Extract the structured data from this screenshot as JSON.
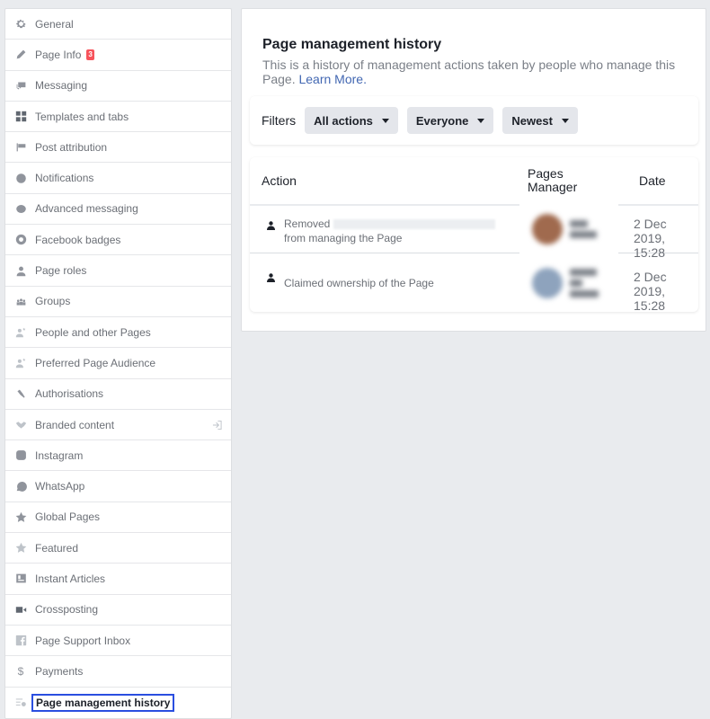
{
  "sidebar": {
    "items": [
      {
        "label": "General",
        "icon": "gear-icon"
      },
      {
        "label": "Page Info",
        "icon": "pencil-icon",
        "badge": "3"
      },
      {
        "label": "Messaging",
        "icon": "chat-bubbles-icon"
      },
      {
        "label": "Templates and tabs",
        "icon": "grid-icon"
      },
      {
        "label": "Post attribution",
        "icon": "flag-icon"
      },
      {
        "label": "Notifications",
        "icon": "globe-icon"
      },
      {
        "label": "Advanced messaging",
        "icon": "messenger-icon"
      },
      {
        "label": "Facebook badges",
        "icon": "badge-icon"
      },
      {
        "label": "Page roles",
        "icon": "person-icon"
      },
      {
        "label": "Groups",
        "icon": "group-icon"
      },
      {
        "label": "People and other Pages",
        "icon": "person-star-icon"
      },
      {
        "label": "Preferred Page Audience",
        "icon": "person-star-icon"
      },
      {
        "label": "Authorisations",
        "icon": "wrench-icon"
      },
      {
        "label": "Branded content",
        "icon": "handshake-icon",
        "trailing_icon": "external-link-icon"
      },
      {
        "label": "Instagram",
        "icon": "instagram-icon"
      },
      {
        "label": "WhatsApp",
        "icon": "whatsapp-icon"
      },
      {
        "label": "Global Pages",
        "icon": "star-icon"
      },
      {
        "label": "Featured",
        "icon": "star-icon"
      },
      {
        "label": "Instant Articles",
        "icon": "article-icon"
      },
      {
        "label": "Crossposting",
        "icon": "video-camera-icon"
      },
      {
        "label": "Page Support Inbox",
        "icon": "facebook-icon"
      },
      {
        "label": "Payments",
        "icon": "dollar-icon"
      },
      {
        "label": "Page management history",
        "icon": "history-list-icon",
        "active": true
      }
    ]
  },
  "main": {
    "title": "Page management history",
    "description": "This is a history of management actions taken by people who manage this Page.",
    "learn_more": "Learn More.",
    "filters": {
      "label": "Filters",
      "buttons": [
        {
          "label": "All actions"
        },
        {
          "label": "Everyone"
        },
        {
          "label": "Newest"
        }
      ]
    },
    "table": {
      "headers": {
        "action": "Action",
        "manager_line1": "Pages",
        "manager_line2": "Manager",
        "date": "Date"
      },
      "rows": [
        {
          "action_prefix": "Removed",
          "action_suffix": "from managing the Page",
          "manager_redacted": true,
          "avatar_color": "#a06a4e",
          "date_line1": "2 Dec 2019,",
          "date_line2": "15:28"
        },
        {
          "action_prefix": "Claimed ownership of the Page",
          "manager_redacted": true,
          "avatar_color": "#8ea3bd",
          "date_line1": "2 Dec 2019,",
          "date_line2": "15:28"
        }
      ]
    }
  },
  "colors": {
    "background": "#e9ebee",
    "link": "#4267b2",
    "badge": "#f7535b",
    "active_outline": "#2a4ee0"
  }
}
